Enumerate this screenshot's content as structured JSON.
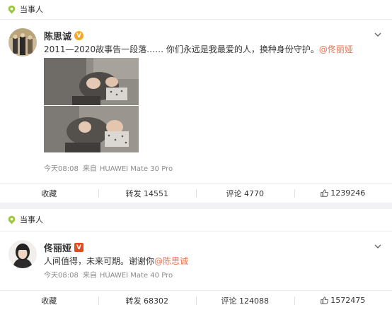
{
  "topic_label": "当事人",
  "posts": [
    {
      "username": "陈思诚",
      "text": "2011—2020故事告一段落…… 你们永远是我最爱的人，换种身份守护。",
      "mention": "@佟丽娅",
      "meta": {
        "time": "今天08:08",
        "source_prefix": "来自",
        "device": "HUAWEI Mate 30 Pro"
      },
      "actions": {
        "favorite": "收藏",
        "repost": "转发 14551",
        "comment": "评论 4770",
        "like": "1239246"
      },
      "colors": {
        "badge": "#f6a623"
      }
    },
    {
      "username": "佟丽娅",
      "text": "人间值得，未来可期。谢谢你",
      "mention": "@陈思诚",
      "meta": {
        "time": "今天08:08",
        "source_prefix": "来自",
        "device": "HUAWEI Mate 40 Pro"
      },
      "actions": {
        "favorite": "收藏",
        "repost": "转发 68302",
        "comment": "评论 124088",
        "like": "1572475"
      },
      "colors": {
        "badge": "#e8481c"
      }
    }
  ],
  "colors": {
    "mention": "#eb7350",
    "topic_pin": "#9bc53d"
  },
  "icons": {
    "topic": "location-pin-icon",
    "menu": "chevron-down-icon",
    "like": "thumbs-up-icon",
    "verified": "verified-badge-icon"
  }
}
